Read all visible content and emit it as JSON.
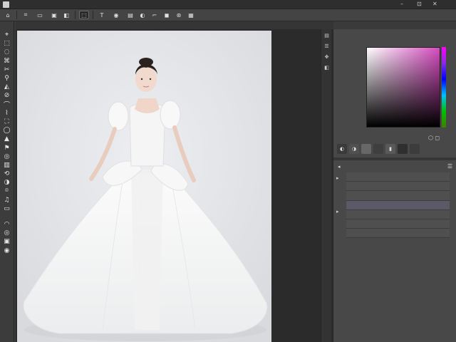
{
  "menubar": {
    "items": [
      "",
      "",
      "",
      "",
      "",
      "",
      ""
    ],
    "window_controls": [
      "–",
      "⊡",
      "✕"
    ]
  },
  "options_bar": {
    "buttons": [
      {
        "icon": "marquee-icon",
        "glyph": "⌗"
      },
      {
        "icon": "document-icon",
        "glyph": "▭"
      },
      {
        "icon": "frame-icon",
        "glyph": "▣"
      },
      {
        "icon": "layer-mask-icon",
        "glyph": "◧"
      },
      {
        "icon": "transform-icon",
        "glyph": "⬚",
        "active": true
      },
      {
        "icon": "text-tool-icon",
        "glyph": "T"
      },
      {
        "icon": "camera-icon",
        "glyph": "◉"
      },
      {
        "icon": "image-icon",
        "glyph": "▤"
      },
      {
        "icon": "eye-icon",
        "glyph": "◐"
      },
      {
        "icon": "cursor-icon",
        "glyph": "⌐"
      },
      {
        "icon": "color-swatch-icon",
        "glyph": "◼"
      },
      {
        "icon": "aperture-icon",
        "glyph": "⊛"
      },
      {
        "icon": "preview-icon",
        "glyph": "▦"
      }
    ]
  },
  "tabs": [
    {
      "label": "",
      "active": true
    },
    {
      "label": ""
    },
    {
      "label": ""
    },
    {
      "label": ""
    }
  ],
  "tools": {
    "group1": [
      "⌖",
      "⬚",
      "◌",
      "⌘",
      "✂",
      "⚲",
      "◭",
      "⊘",
      "⌒",
      "⌇",
      "⛶",
      "◯",
      "▲",
      "⚑",
      "◎",
      "▥",
      "⟲",
      "◑",
      "⌾",
      "♫",
      "▭"
    ],
    "group2": [
      "◠",
      "◎",
      "▣",
      "◉"
    ]
  },
  "dock": [
    "▤",
    "☰",
    "✥",
    "◧"
  ],
  "color_panel": {
    "tabs": [
      "",
      ""
    ],
    "picker_tools": [
      "",
      "",
      ""
    ],
    "foreground_color": "#d64bbf",
    "label": "",
    "swatches": [
      "#3a3a3a",
      "#505050",
      "#676767",
      "#3f3f3f",
      "#595959",
      "#2f2f2f",
      "#3c3c3c"
    ]
  },
  "layers_panel": {
    "tab_left": "",
    "tab_right": "",
    "menu_glyph": "☰",
    "rows": [
      {
        "label": "",
        "icon": ""
      },
      {
        "label": "",
        "icon": ""
      },
      {
        "label": "",
        "icon": ""
      },
      {
        "label": "",
        "icon": "",
        "selected": true
      },
      {
        "label": "",
        "icon": ""
      },
      {
        "label": "",
        "icon": ""
      },
      {
        "label": "",
        "icon": ""
      }
    ]
  }
}
